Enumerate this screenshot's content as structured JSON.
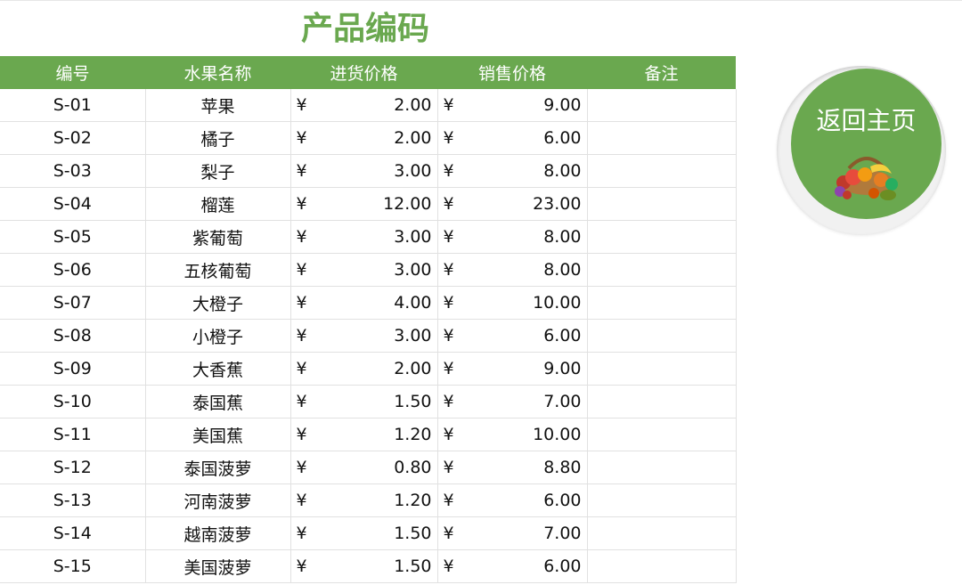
{
  "title": "产品编码",
  "home_button": {
    "label": "返回主页",
    "icon": "fruit-basket-icon"
  },
  "colors": {
    "accent": "#6aa84f",
    "header_text": "#ffffff",
    "grid": "#e1e1e1"
  },
  "table": {
    "headers": [
      "编号",
      "水果名称",
      "进货价格",
      "销售价格",
      "备注"
    ],
    "currency": "¥",
    "rows": [
      {
        "code": "S-01",
        "name": "苹果",
        "cost": "2.00",
        "price": "9.00",
        "note": ""
      },
      {
        "code": "S-02",
        "name": "橘子",
        "cost": "2.00",
        "price": "6.00",
        "note": ""
      },
      {
        "code": "S-03",
        "name": "梨子",
        "cost": "3.00",
        "price": "8.00",
        "note": ""
      },
      {
        "code": "S-04",
        "name": "榴莲",
        "cost": "12.00",
        "price": "23.00",
        "note": ""
      },
      {
        "code": "S-05",
        "name": "紫葡萄",
        "cost": "3.00",
        "price": "8.00",
        "note": ""
      },
      {
        "code": "S-06",
        "name": "五核葡萄",
        "cost": "3.00",
        "price": "8.00",
        "note": ""
      },
      {
        "code": "S-07",
        "name": "大橙子",
        "cost": "4.00",
        "price": "10.00",
        "note": ""
      },
      {
        "code": "S-08",
        "name": "小橙子",
        "cost": "3.00",
        "price": "6.00",
        "note": ""
      },
      {
        "code": "S-09",
        "name": "大香蕉",
        "cost": "2.00",
        "price": "9.00",
        "note": ""
      },
      {
        "code": "S-10",
        "name": "泰国蕉",
        "cost": "1.50",
        "price": "7.00",
        "note": ""
      },
      {
        "code": "S-11",
        "name": "美国蕉",
        "cost": "1.20",
        "price": "10.00",
        "note": ""
      },
      {
        "code": "S-12",
        "name": "泰国菠萝",
        "cost": "0.80",
        "price": "8.80",
        "note": ""
      },
      {
        "code": "S-13",
        "name": "河南菠萝",
        "cost": "1.20",
        "price": "6.00",
        "note": ""
      },
      {
        "code": "S-14",
        "name": "越南菠萝",
        "cost": "1.50",
        "price": "7.00",
        "note": ""
      },
      {
        "code": "S-15",
        "name": "美国菠萝",
        "cost": "1.50",
        "price": "6.00",
        "note": ""
      }
    ]
  }
}
